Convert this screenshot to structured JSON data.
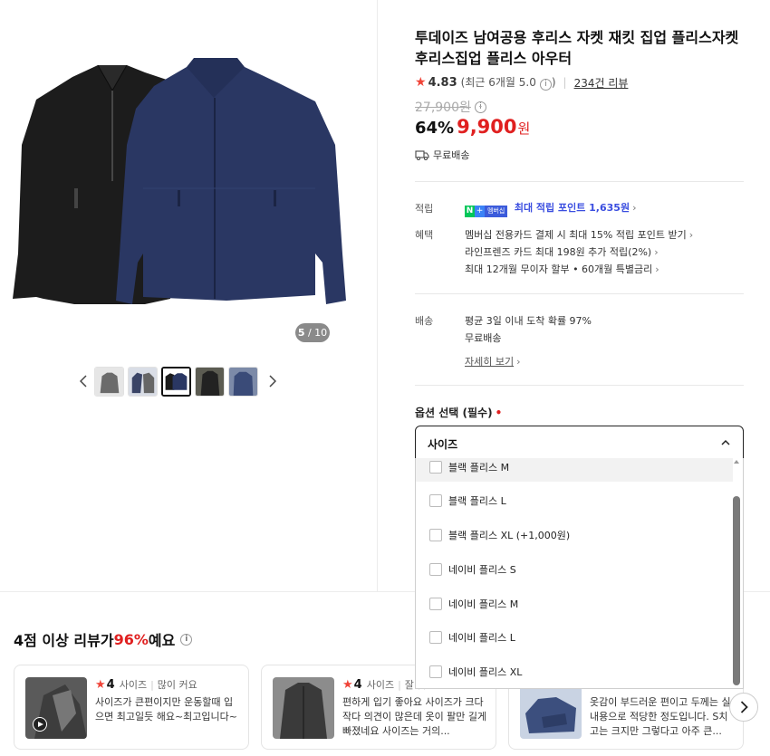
{
  "gallery": {
    "page_current": "5",
    "page_total": "/ 10",
    "thumb_count": 5,
    "active_thumb": 2,
    "prev_icon": "chevron-left-icon",
    "next_icon": "chevron-right-icon"
  },
  "product": {
    "title": "투데이즈 남여공용 후리스 자켓 재킷 집업 플리스자켓 후리스집업 플리스 아우터",
    "rating_score": "4.83",
    "rating_recent": "(최근 6개월 5.0",
    "rating_recent_close": ")",
    "review_count": "234건 리뷰",
    "original_price": "27,900원",
    "discount": "64%",
    "sale_price": "9,900",
    "currency": "원",
    "shipping_tag": "무료배송"
  },
  "benefits": {
    "points_label": "적립",
    "membership_badge": "멤버십",
    "points_text": "최대 적립 포인트 1,635원",
    "perks_label": "혜택",
    "perks": [
      "멤버십 전용카드 결제 시 최대 15% 적립 포인트 받기",
      "라인프렌즈 카드 최대 198원 추가 적립(2%)",
      "최대 12개월 무이자 할부 • 60개월 특별금리"
    ]
  },
  "delivery": {
    "label": "배송",
    "line1": "평균 3일 이내 도착 확률 97%",
    "line2": "무료배송",
    "detail_link": "자세히 보기"
  },
  "options": {
    "label": "옵션 선택 (필수)",
    "required_mark": "•",
    "select_value": "사이즈",
    "items": [
      "블랙 플리스 M",
      "블랙 플리스 L",
      "블랙 플리스 XL (+1,000원)",
      "네이비 플리스 S",
      "네이비 플리스 M",
      "네이비 플리스 L",
      "네이비 플리스 XL"
    ]
  },
  "reviews": {
    "headline_prefix": "4점 이상 리뷰가 ",
    "headline_pct": "96%",
    "headline_suffix": "예요",
    "cards": [
      {
        "score": "4",
        "attr": "사이즈",
        "attr_value": "많이 커요",
        "text": "사이즈가 큰편이지만 운동할때 입으면 최고일듯 해요~최고입니다~"
      },
      {
        "score": "4",
        "attr": "사이즈",
        "attr_value": "잘 맞",
        "text": "편하게 입기 좋아요 사이즈가 크다 작다 의견이 많은데 옷이 팔만 길게 빠졌네요 사이즈는 거의..."
      },
      {
        "score": "",
        "attr": "",
        "attr_value": "",
        "text": "옷감이 부드러운 편이고 두께는 실내용으로 적당한 정도입니다. S치고는 크지만 그렇다고 아주 큰..."
      }
    ]
  },
  "colors": {
    "accent_red": "#e02020",
    "star": "#f04438",
    "point_blue": "#3b4ee0",
    "naver_green": "#03c75a"
  }
}
